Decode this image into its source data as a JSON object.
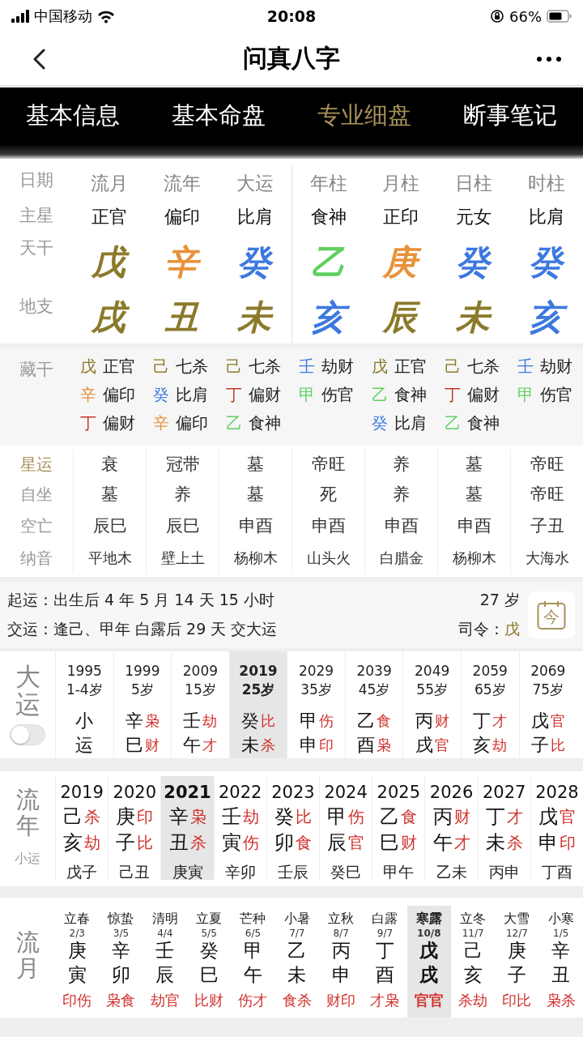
{
  "status_bar": {
    "carrier": "中国移动",
    "time": "20:08",
    "battery": "66%"
  },
  "nav": {
    "title": "问真八字"
  },
  "tabs": [
    {
      "label": "基本信息",
      "selected": false
    },
    {
      "label": "基本命盘",
      "selected": false
    },
    {
      "label": "专业细盘",
      "selected": true
    },
    {
      "label": "断事笔记",
      "selected": false
    }
  ],
  "chart": {
    "row_labels": [
      "日期",
      "主星",
      "天干",
      "地支"
    ],
    "pillars": [
      {
        "title": "流月",
        "star": "正官",
        "stem": {
          "char": "戊",
          "color": "#8b7a2b"
        },
        "branch": {
          "char": "戌",
          "color": "#8b7a2b"
        }
      },
      {
        "title": "流年",
        "star": "偏印",
        "stem": {
          "char": "辛",
          "color": "#e8923a"
        },
        "branch": {
          "char": "丑",
          "color": "#8b7a2b"
        }
      },
      {
        "title": "大运",
        "star": "比肩",
        "stem": {
          "char": "癸",
          "color": "#3d78e0"
        },
        "branch": {
          "char": "未",
          "color": "#8b7a2b"
        }
      },
      {
        "title": "年柱",
        "star": "食神",
        "stem": {
          "char": "乙",
          "color": "#5fd05f"
        },
        "branch": {
          "char": "亥",
          "color": "#3d78e0"
        }
      },
      {
        "title": "月柱",
        "star": "正印",
        "stem": {
          "char": "庚",
          "color": "#e8923a"
        },
        "branch": {
          "char": "辰",
          "color": "#8b7a2b"
        }
      },
      {
        "title": "日柱",
        "star": "元女",
        "stem": {
          "char": "癸",
          "color": "#3d78e0"
        },
        "branch": {
          "char": "未",
          "color": "#8b7a2b"
        }
      },
      {
        "title": "时柱",
        "star": "比肩",
        "stem": {
          "char": "癸",
          "color": "#3d78e0"
        },
        "branch": {
          "char": "亥",
          "color": "#3d78e0"
        }
      }
    ]
  },
  "hidden_stems": {
    "label": "藏干",
    "columns": [
      [
        {
          "stem": "戊",
          "color": "#8b7a2b",
          "god": "正官"
        },
        {
          "stem": "辛",
          "color": "#e8923a",
          "god": "偏印"
        },
        {
          "stem": "丁",
          "color": "#c0392b",
          "god": "偏财"
        }
      ],
      [
        {
          "stem": "己",
          "color": "#8b7a2b",
          "god": "七杀"
        },
        {
          "stem": "癸",
          "color": "#3d78e0",
          "god": "比肩"
        },
        {
          "stem": "辛",
          "color": "#e8923a",
          "god": "偏印"
        }
      ],
      [
        {
          "stem": "己",
          "color": "#8b7a2b",
          "god": "七杀"
        },
        {
          "stem": "丁",
          "color": "#c0392b",
          "god": "偏财"
        },
        {
          "stem": "乙",
          "color": "#5fd05f",
          "god": "食神"
        }
      ],
      [
        {
          "stem": "壬",
          "color": "#3d78e0",
          "god": "劫财"
        },
        {
          "stem": "甲",
          "color": "#5fd05f",
          "god": "伤官"
        }
      ],
      [
        {
          "stem": "戊",
          "color": "#8b7a2b",
          "god": "正官"
        },
        {
          "stem": "乙",
          "color": "#5fd05f",
          "god": "食神"
        },
        {
          "stem": "癸",
          "color": "#3d78e0",
          "god": "比肩"
        }
      ],
      [
        {
          "stem": "己",
          "color": "#8b7a2b",
          "god": "七杀"
        },
        {
          "stem": "丁",
          "color": "#c0392b",
          "god": "偏财"
        },
        {
          "stem": "乙",
          "color": "#5fd05f",
          "god": "食神"
        }
      ],
      [
        {
          "stem": "壬",
          "color": "#3d78e0",
          "god": "劫财"
        },
        {
          "stem": "甲",
          "color": "#5fd05f",
          "god": "伤官"
        }
      ]
    ]
  },
  "details": {
    "rows": [
      {
        "label": "星运",
        "color": "#a8925a",
        "values": [
          "衰",
          "冠带",
          "墓",
          "帝旺",
          "养",
          "墓",
          "帝旺"
        ]
      },
      {
        "label": "自坐",
        "color": "#999999",
        "values": [
          "墓",
          "养",
          "墓",
          "死",
          "养",
          "墓",
          "帝旺"
        ]
      },
      {
        "label": "空亡",
        "color": "#999999",
        "values": [
          "辰巳",
          "辰巳",
          "申酉",
          "申酉",
          "申酉",
          "申酉",
          "子丑"
        ]
      },
      {
        "label": "纳音",
        "color": "#999999",
        "values": [
          "平地木",
          "壁上土",
          "杨柳木",
          "山头火",
          "白腊金",
          "杨柳木",
          "大海水"
        ]
      }
    ]
  },
  "qiyun": {
    "start_label": "起运：",
    "start_value": "出生后 4 年 5 月 14 天 15 小时",
    "age": "27 岁",
    "jiaoyun_label": "交运：",
    "jiaoyun_value": "逢己、甲年 白露后 29 天 交大运",
    "siling_label": "司令：",
    "siling_value": "戊",
    "today_button": "今"
  },
  "dayun": {
    "label": "大运",
    "toggle_on": false,
    "items": [
      {
        "year": "1995",
        "age": "1-4岁",
        "stem": "小",
        "branch": "运",
        "selected": false
      },
      {
        "year": "1999",
        "age": "5岁",
        "stem": "辛",
        "stem_god": "枭",
        "branch": "巳",
        "branch_god": "财",
        "selected": false
      },
      {
        "year": "2009",
        "age": "15岁",
        "stem": "壬",
        "stem_god": "劫",
        "branch": "午",
        "branch_god": "才",
        "selected": false
      },
      {
        "year": "2019",
        "age": "25岁",
        "stem": "癸",
        "stem_god": "比",
        "branch": "未",
        "branch_god": "杀",
        "selected": true
      },
      {
        "year": "2029",
        "age": "35岁",
        "stem": "甲",
        "stem_god": "伤",
        "branch": "申",
        "branch_god": "印",
        "selected": false
      },
      {
        "year": "2039",
        "age": "45岁",
        "stem": "乙",
        "stem_god": "食",
        "branch": "酉",
        "branch_god": "枭",
        "selected": false
      },
      {
        "year": "2049",
        "age": "55岁",
        "stem": "丙",
        "stem_god": "财",
        "branch": "戌",
        "branch_god": "官",
        "selected": false
      },
      {
        "year": "2059",
        "age": "65岁",
        "stem": "丁",
        "stem_god": "才",
        "branch": "亥",
        "branch_god": "劫",
        "selected": false
      },
      {
        "year": "2069",
        "age": "75岁",
        "stem": "戊",
        "stem_god": "官",
        "branch": "子",
        "branch_god": "比",
        "selected": false
      }
    ]
  },
  "liunian": {
    "label": "流年",
    "sub_label": "小运",
    "items": [
      {
        "year": "2019",
        "stem": "己",
        "stem_god": "杀",
        "branch": "亥",
        "branch_god": "劫",
        "xiaoyun": "戊子",
        "selected": false
      },
      {
        "year": "2020",
        "stem": "庚",
        "stem_god": "印",
        "branch": "子",
        "branch_god": "比",
        "xiaoyun": "己丑",
        "selected": false
      },
      {
        "year": "2021",
        "stem": "辛",
        "stem_god": "枭",
        "branch": "丑",
        "branch_god": "杀",
        "xiaoyun": "庚寅",
        "selected": true
      },
      {
        "year": "2022",
        "stem": "壬",
        "stem_god": "劫",
        "branch": "寅",
        "branch_god": "伤",
        "xiaoyun": "辛卯",
        "selected": false
      },
      {
        "year": "2023",
        "stem": "癸",
        "stem_god": "比",
        "branch": "卯",
        "branch_god": "食",
        "xiaoyun": "壬辰",
        "selected": false
      },
      {
        "year": "2024",
        "stem": "甲",
        "stem_god": "伤",
        "branch": "辰",
        "branch_god": "官",
        "xiaoyun": "癸巳",
        "selected": false
      },
      {
        "year": "2025",
        "stem": "乙",
        "stem_god": "食",
        "branch": "巳",
        "branch_god": "财",
        "xiaoyun": "甲午",
        "selected": false
      },
      {
        "year": "2026",
        "stem": "丙",
        "stem_god": "财",
        "branch": "午",
        "branch_god": "才",
        "xiaoyun": "乙未",
        "selected": false
      },
      {
        "year": "2027",
        "stem": "丁",
        "stem_god": "才",
        "branch": "未",
        "branch_god": "杀",
        "xiaoyun": "丙申",
        "selected": false
      },
      {
        "year": "2028",
        "stem": "戊",
        "stem_god": "官",
        "branch": "申",
        "branch_god": "印",
        "xiaoyun": "丁酉",
        "selected": false
      }
    ]
  },
  "liuyue": {
    "label": "流月",
    "items": [
      {
        "term": "立春",
        "date": "2/3",
        "stem": "庚",
        "branch": "寅",
        "gods": "印伤",
        "selected": false
      },
      {
        "term": "惊蛰",
        "date": "3/5",
        "stem": "辛",
        "branch": "卯",
        "gods": "枭食",
        "selected": false
      },
      {
        "term": "清明",
        "date": "4/4",
        "stem": "壬",
        "branch": "辰",
        "gods": "劫官",
        "selected": false
      },
      {
        "term": "立夏",
        "date": "5/5",
        "stem": "癸",
        "branch": "巳",
        "gods": "比财",
        "selected": false
      },
      {
        "term": "芒种",
        "date": "6/5",
        "stem": "甲",
        "branch": "午",
        "gods": "伤才",
        "selected": false
      },
      {
        "term": "小暑",
        "date": "7/7",
        "stem": "乙",
        "branch": "未",
        "gods": "食杀",
        "selected": false
      },
      {
        "term": "立秋",
        "date": "8/7",
        "stem": "丙",
        "branch": "申",
        "gods": "财印",
        "selected": false
      },
      {
        "term": "白露",
        "date": "9/7",
        "stem": "丁",
        "branch": "酉",
        "gods": "才枭",
        "selected": false
      },
      {
        "term": "寒露",
        "date": "10/8",
        "stem": "戊",
        "branch": "戌",
        "gods": "官官",
        "selected": true
      },
      {
        "term": "立冬",
        "date": "11/7",
        "stem": "己",
        "branch": "亥",
        "gods": "杀劫",
        "selected": false
      },
      {
        "term": "大雪",
        "date": "12/7",
        "stem": "庚",
        "branch": "子",
        "gods": "印比",
        "selected": false
      },
      {
        "term": "小寒",
        "date": "1/5",
        "stem": "辛",
        "branch": "丑",
        "gods": "枭杀",
        "selected": false
      }
    ]
  }
}
